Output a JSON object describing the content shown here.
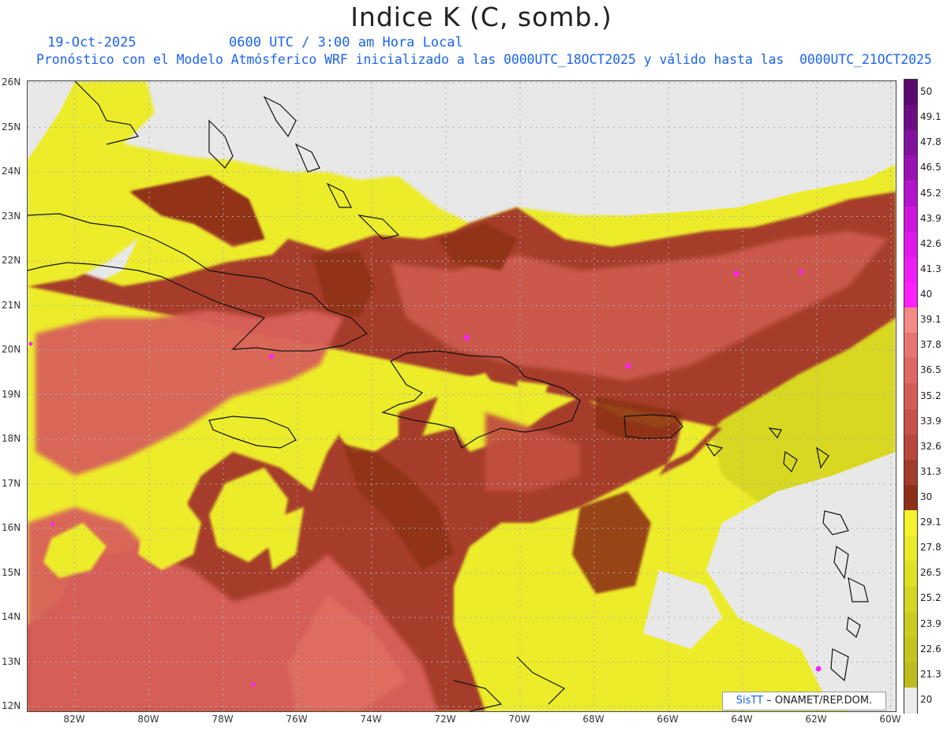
{
  "header": {
    "title": "Indice K (C, somb.)",
    "date": "19-Oct-2025",
    "time": "0600 UTC / 3:00 am Hora Local",
    "description": "Pronóstico con el Modelo Atmósferico WRF inicializado a las 0000UTC_18OCT2025 y válido hasta las  0000UTC_21OCT2025"
  },
  "map": {
    "latitudes": [
      "26N",
      "25N",
      "24N",
      "23N",
      "22N",
      "21N",
      "20N",
      "19N",
      "18N",
      "17N",
      "16N",
      "15N",
      "14N",
      "13N",
      "12N"
    ],
    "longitudes": [
      "82W",
      "80W",
      "78W",
      "76W",
      "74W",
      "72W",
      "70W",
      "68W",
      "66W",
      "64W",
      "62W",
      "60W"
    ],
    "lat_range": [
      12,
      26
    ],
    "lon_range": [
      -83.2,
      -59.9
    ],
    "grid": true,
    "coastline_color": "#111111"
  },
  "colorbar": {
    "labels": [
      "50",
      "49.1",
      "47.8",
      "46.5",
      "45.2",
      "43.9",
      "42.6",
      "41.3",
      "40",
      "39.1",
      "37.8",
      "36.5",
      "35.2",
      "33.9",
      "32.6",
      "31.3",
      "30",
      "29.1",
      "27.8",
      "26.5",
      "25.2",
      "23.9",
      "22.6",
      "21.3",
      "20"
    ],
    "colors": [
      "#5a0a6e",
      "#6e0c86",
      "#82109c",
      "#9a12b4",
      "#b414cc",
      "#cc16de",
      "#e018ec",
      "#f01cf8",
      "#ff20ff",
      "#f48a86",
      "#e87470",
      "#de6862",
      "#d45e56",
      "#c8524a",
      "#b8483c",
      "#a43c2e",
      "#8e3018",
      "#f4f32c",
      "#eaea28",
      "#e0e024",
      "#d4d422",
      "#cccc20",
      "#c4c41e",
      "#bcbc1c",
      "#ececec"
    ]
  },
  "credit": {
    "brand": "SisTT",
    "text": "– ONAMET/REP.DOM."
  }
}
